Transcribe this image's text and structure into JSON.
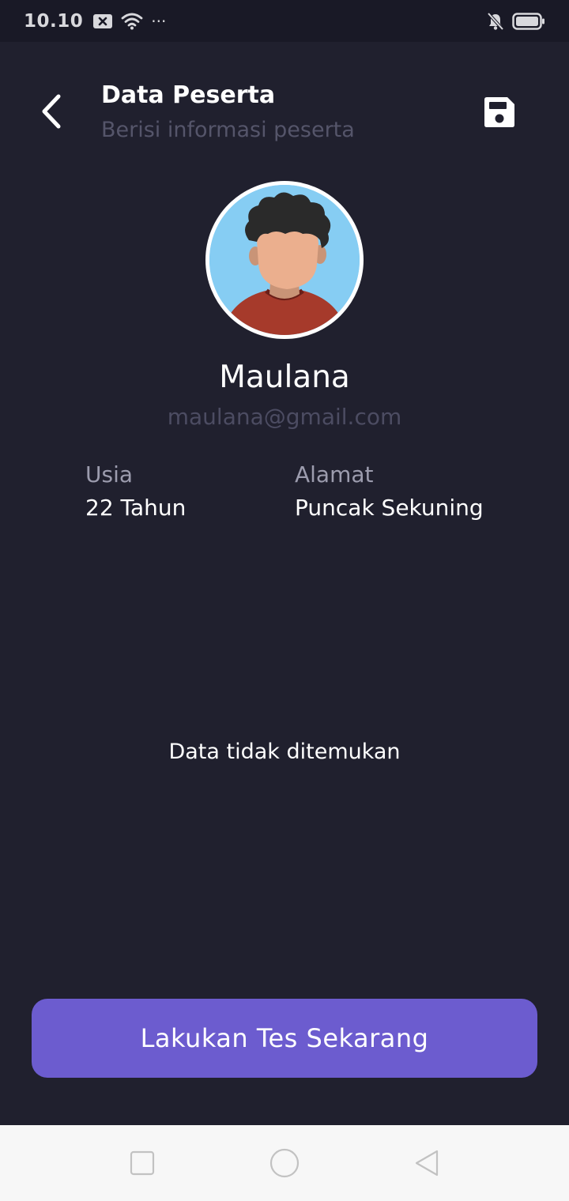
{
  "status_bar": {
    "time": "10.10",
    "left_icons": [
      "notification-x-icon",
      "wifi-icon",
      "more-icon"
    ],
    "right_icons": [
      "silent-icon",
      "battery-icon"
    ],
    "more_glyph": "···"
  },
  "header": {
    "title": "Data Peserta",
    "subtitle": "Berisi informasi peserta",
    "back_icon": "chevron-left-icon",
    "save_icon": "save-icon"
  },
  "profile": {
    "name": "Maulana",
    "email": "maulana@gmail.com",
    "age_label": "Usia",
    "age_value": "22 Tahun",
    "address_label": "Alamat",
    "address_value": "Puncak Sekuning"
  },
  "empty_state": {
    "message": "Data tidak ditemukan"
  },
  "cta": {
    "label": "Lakukan Tes Sekarang"
  },
  "nav_bar": {
    "icons": [
      "recent-apps-icon",
      "home-icon",
      "back-triangle-icon"
    ]
  },
  "colors": {
    "background": "#20202e",
    "status_bar": "#191926",
    "accent": "#6c5ccf",
    "muted_text": "#55556a",
    "avatar_bg": "#86cdf3"
  }
}
